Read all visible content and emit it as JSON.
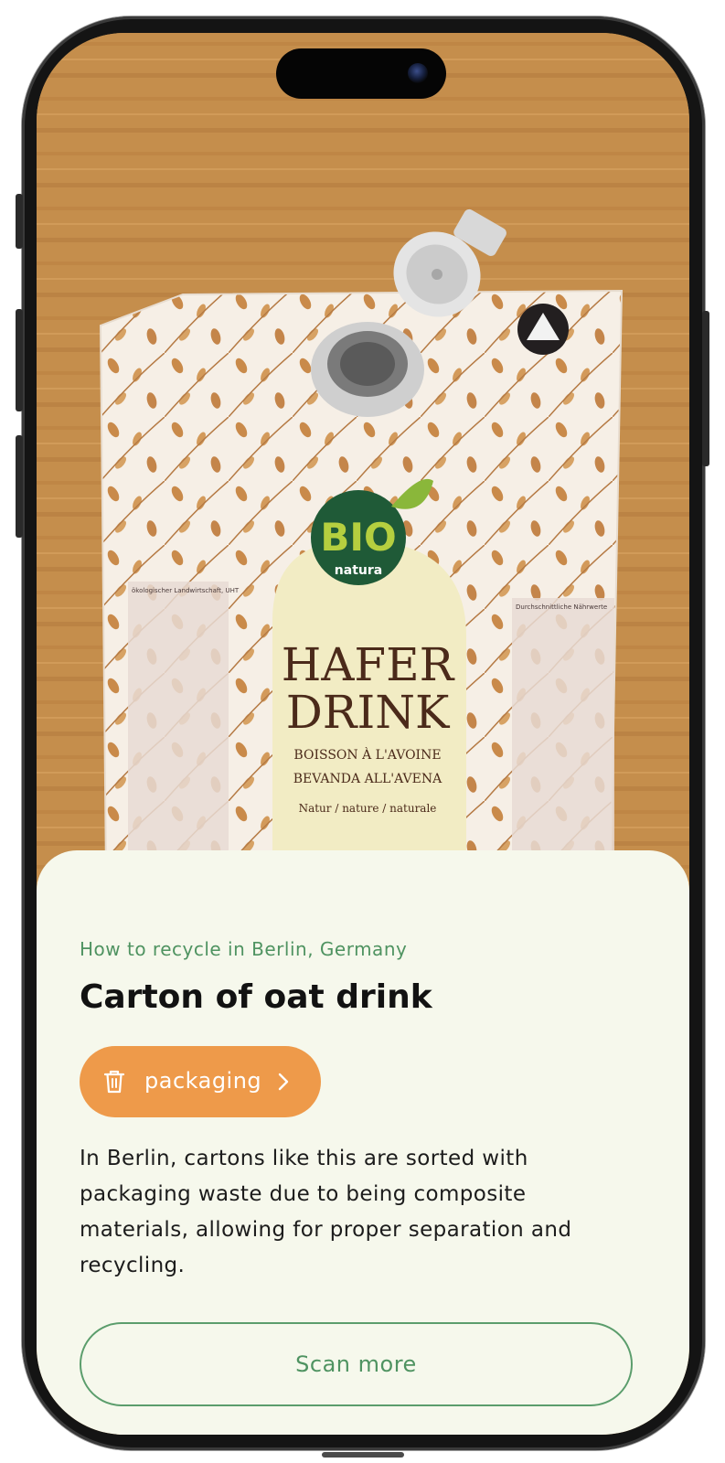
{
  "photo": {
    "product_label": {
      "brand_line1": "BIO",
      "brand_line2": "natura",
      "title_line1": "HAFER",
      "title_line2": "DRINK",
      "subtitle_line1": "BOISSON À L'AVOINE",
      "subtitle_line2": "BEVANDA ALL'AVENA",
      "variant": "Natur / nature / naturale"
    },
    "side_panel_left": "ökologischer Landwirtschaft, UHT",
    "side_panel_right": "Durchschnittliche Nährwerte"
  },
  "result": {
    "location": "How to recycle in Berlin, Germany",
    "title": "Carton of oat drink",
    "category_label": "packaging",
    "category_icon": "trash-icon",
    "description": "In Berlin, cartons like this are sorted with packaging waste due to being composite materials, allowing for proper separation and recycling.",
    "scan_more_label": "Scan more"
  },
  "colors": {
    "accent_green": "#4f9361",
    "chip_orange": "#ee9a4a",
    "sheet_background": "#f6f8ec"
  }
}
